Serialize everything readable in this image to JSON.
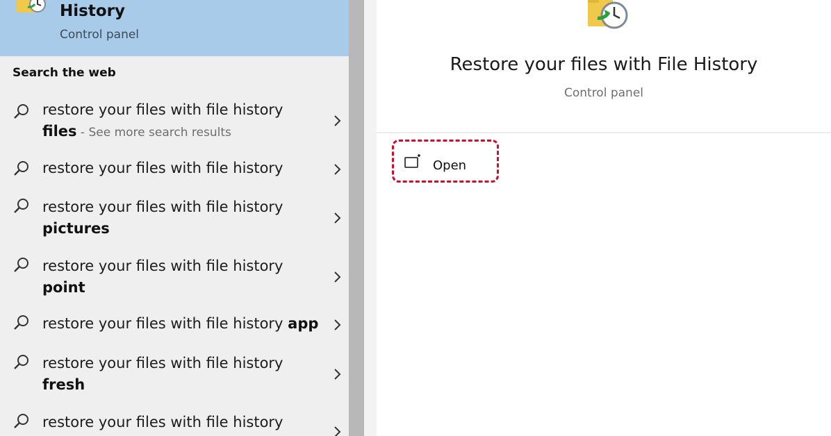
{
  "best_match": {
    "title": "History",
    "subtitle": "Control panel",
    "icon": "file-history-folder-clock-icon"
  },
  "search_web": {
    "heading": "Search the web",
    "items": [
      {
        "line1": "restore your files with file history",
        "line2_bold": "files",
        "line2_hint": " - See more search results"
      },
      {
        "line1": "restore your files with file history",
        "line1_bold": ""
      },
      {
        "line1": "restore your files with file history",
        "line2_bold": "pictures"
      },
      {
        "line1": "restore your files with file history",
        "line2_bold": "point"
      },
      {
        "line1": "restore your files with file history ",
        "line1_bold": "app"
      },
      {
        "line1": "restore your files with file history",
        "line2_bold": "fresh"
      },
      {
        "line1": "restore your files with file history"
      }
    ]
  },
  "detail": {
    "title": "Restore your files with File History",
    "subtitle": "Control panel",
    "open_label": "Open",
    "icon": "file-history-folder-clock-icon"
  },
  "colors": {
    "selection": "#a9cbea",
    "highlight_border": "#c8102e",
    "pane_bg": "#efefef"
  }
}
